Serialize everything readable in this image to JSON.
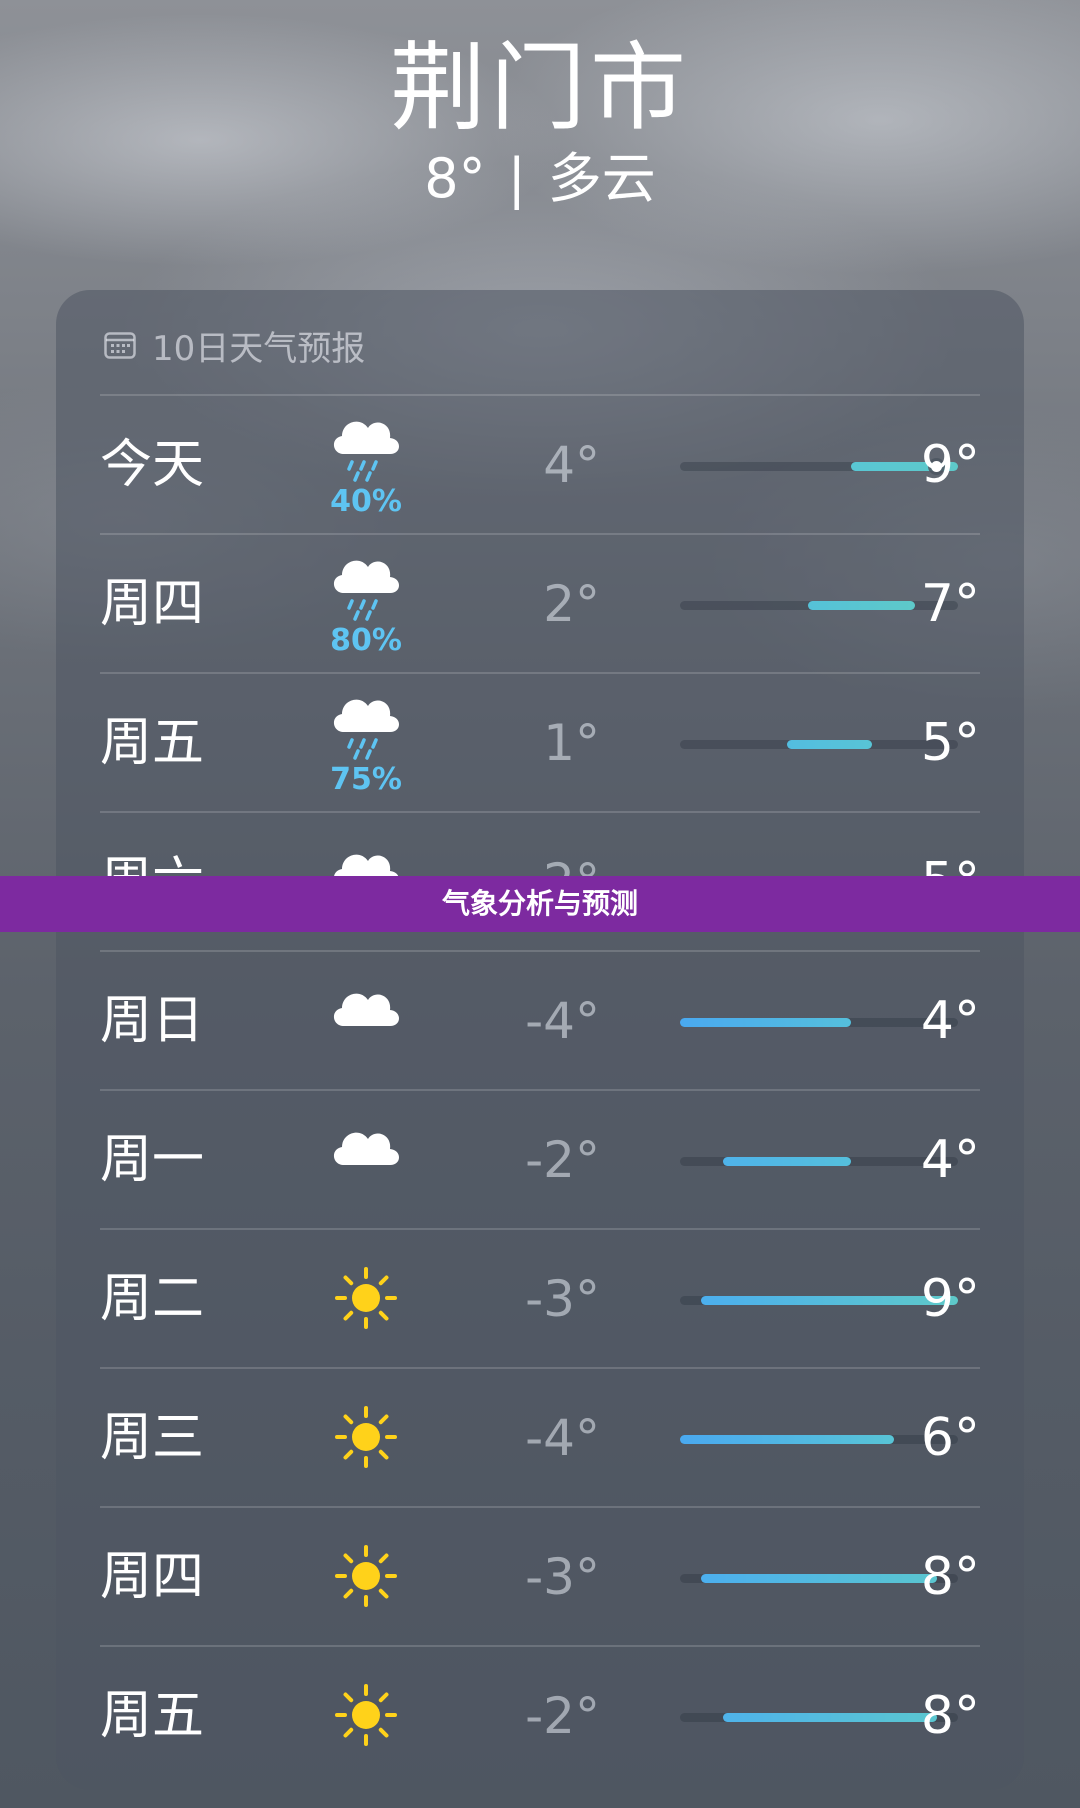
{
  "header": {
    "city": "荆门市",
    "temperature": "8°",
    "separator": "|",
    "condition": "多云"
  },
  "forecast": {
    "title": "10日天气预报",
    "range_min": -4,
    "range_max": 9,
    "current_temp": 8,
    "days": [
      {
        "day": "今天",
        "icon": "cloud-rain-icon",
        "precip": "40%",
        "low": "4°",
        "high": "9°",
        "low_val": 4,
        "high_val": 9,
        "color_from": "#59c7d4",
        "color_to": "#5ec9c9",
        "show_now": true
      },
      {
        "day": "周四",
        "icon": "cloud-rain-icon",
        "precip": "80%",
        "low": "2°",
        "high": "7°",
        "low_val": 2,
        "high_val": 7,
        "color_from": "#55c2d8",
        "color_to": "#5ec9c9"
      },
      {
        "day": "周五",
        "icon": "cloud-rain-icon",
        "precip": "75%",
        "low": "1°",
        "high": "5°",
        "low_val": 1,
        "high_val": 5,
        "color_from": "#53bde0",
        "color_to": "#58c4d6"
      },
      {
        "day": "周六",
        "icon": "cloud-icon",
        "precip": "",
        "low": "-2°",
        "high": "5°",
        "low_val": -2,
        "high_val": 5,
        "color_from": "#4fb3ea",
        "color_to": "#57c2d8"
      },
      {
        "day": "周日",
        "icon": "cloud-icon",
        "precip": "",
        "low": "-4°",
        "high": "4°",
        "low_val": -4,
        "high_val": 4,
        "color_from": "#4aa9f0",
        "color_to": "#55bfdc"
      },
      {
        "day": "周一",
        "icon": "cloud-icon",
        "precip": "",
        "low": "-2°",
        "high": "4°",
        "low_val": -2,
        "high_val": 4,
        "color_from": "#4fb3ea",
        "color_to": "#55bfdc"
      },
      {
        "day": "周二",
        "icon": "sun-icon",
        "precip": "",
        "low": "-3°",
        "high": "9°",
        "low_val": -3,
        "high_val": 9,
        "color_from": "#4cafee",
        "color_to": "#5ec9c9"
      },
      {
        "day": "周三",
        "icon": "sun-icon",
        "precip": "",
        "low": "-4°",
        "high": "6°",
        "low_val": -4,
        "high_val": 6,
        "color_from": "#4aa9f0",
        "color_to": "#58c4d6"
      },
      {
        "day": "周四",
        "icon": "sun-icon",
        "precip": "",
        "low": "-3°",
        "high": "8°",
        "low_val": -3,
        "high_val": 8,
        "color_from": "#4cafee",
        "color_to": "#5ac6d0"
      },
      {
        "day": "周五",
        "icon": "sun-icon",
        "precip": "",
        "low": "-2°",
        "high": "8°",
        "low_val": -2,
        "high_val": 8,
        "color_from": "#4fb3ea",
        "color_to": "#5ac6d0"
      }
    ]
  },
  "banner": {
    "text": "气象分析与预测",
    "color": "#7d2aa0"
  }
}
